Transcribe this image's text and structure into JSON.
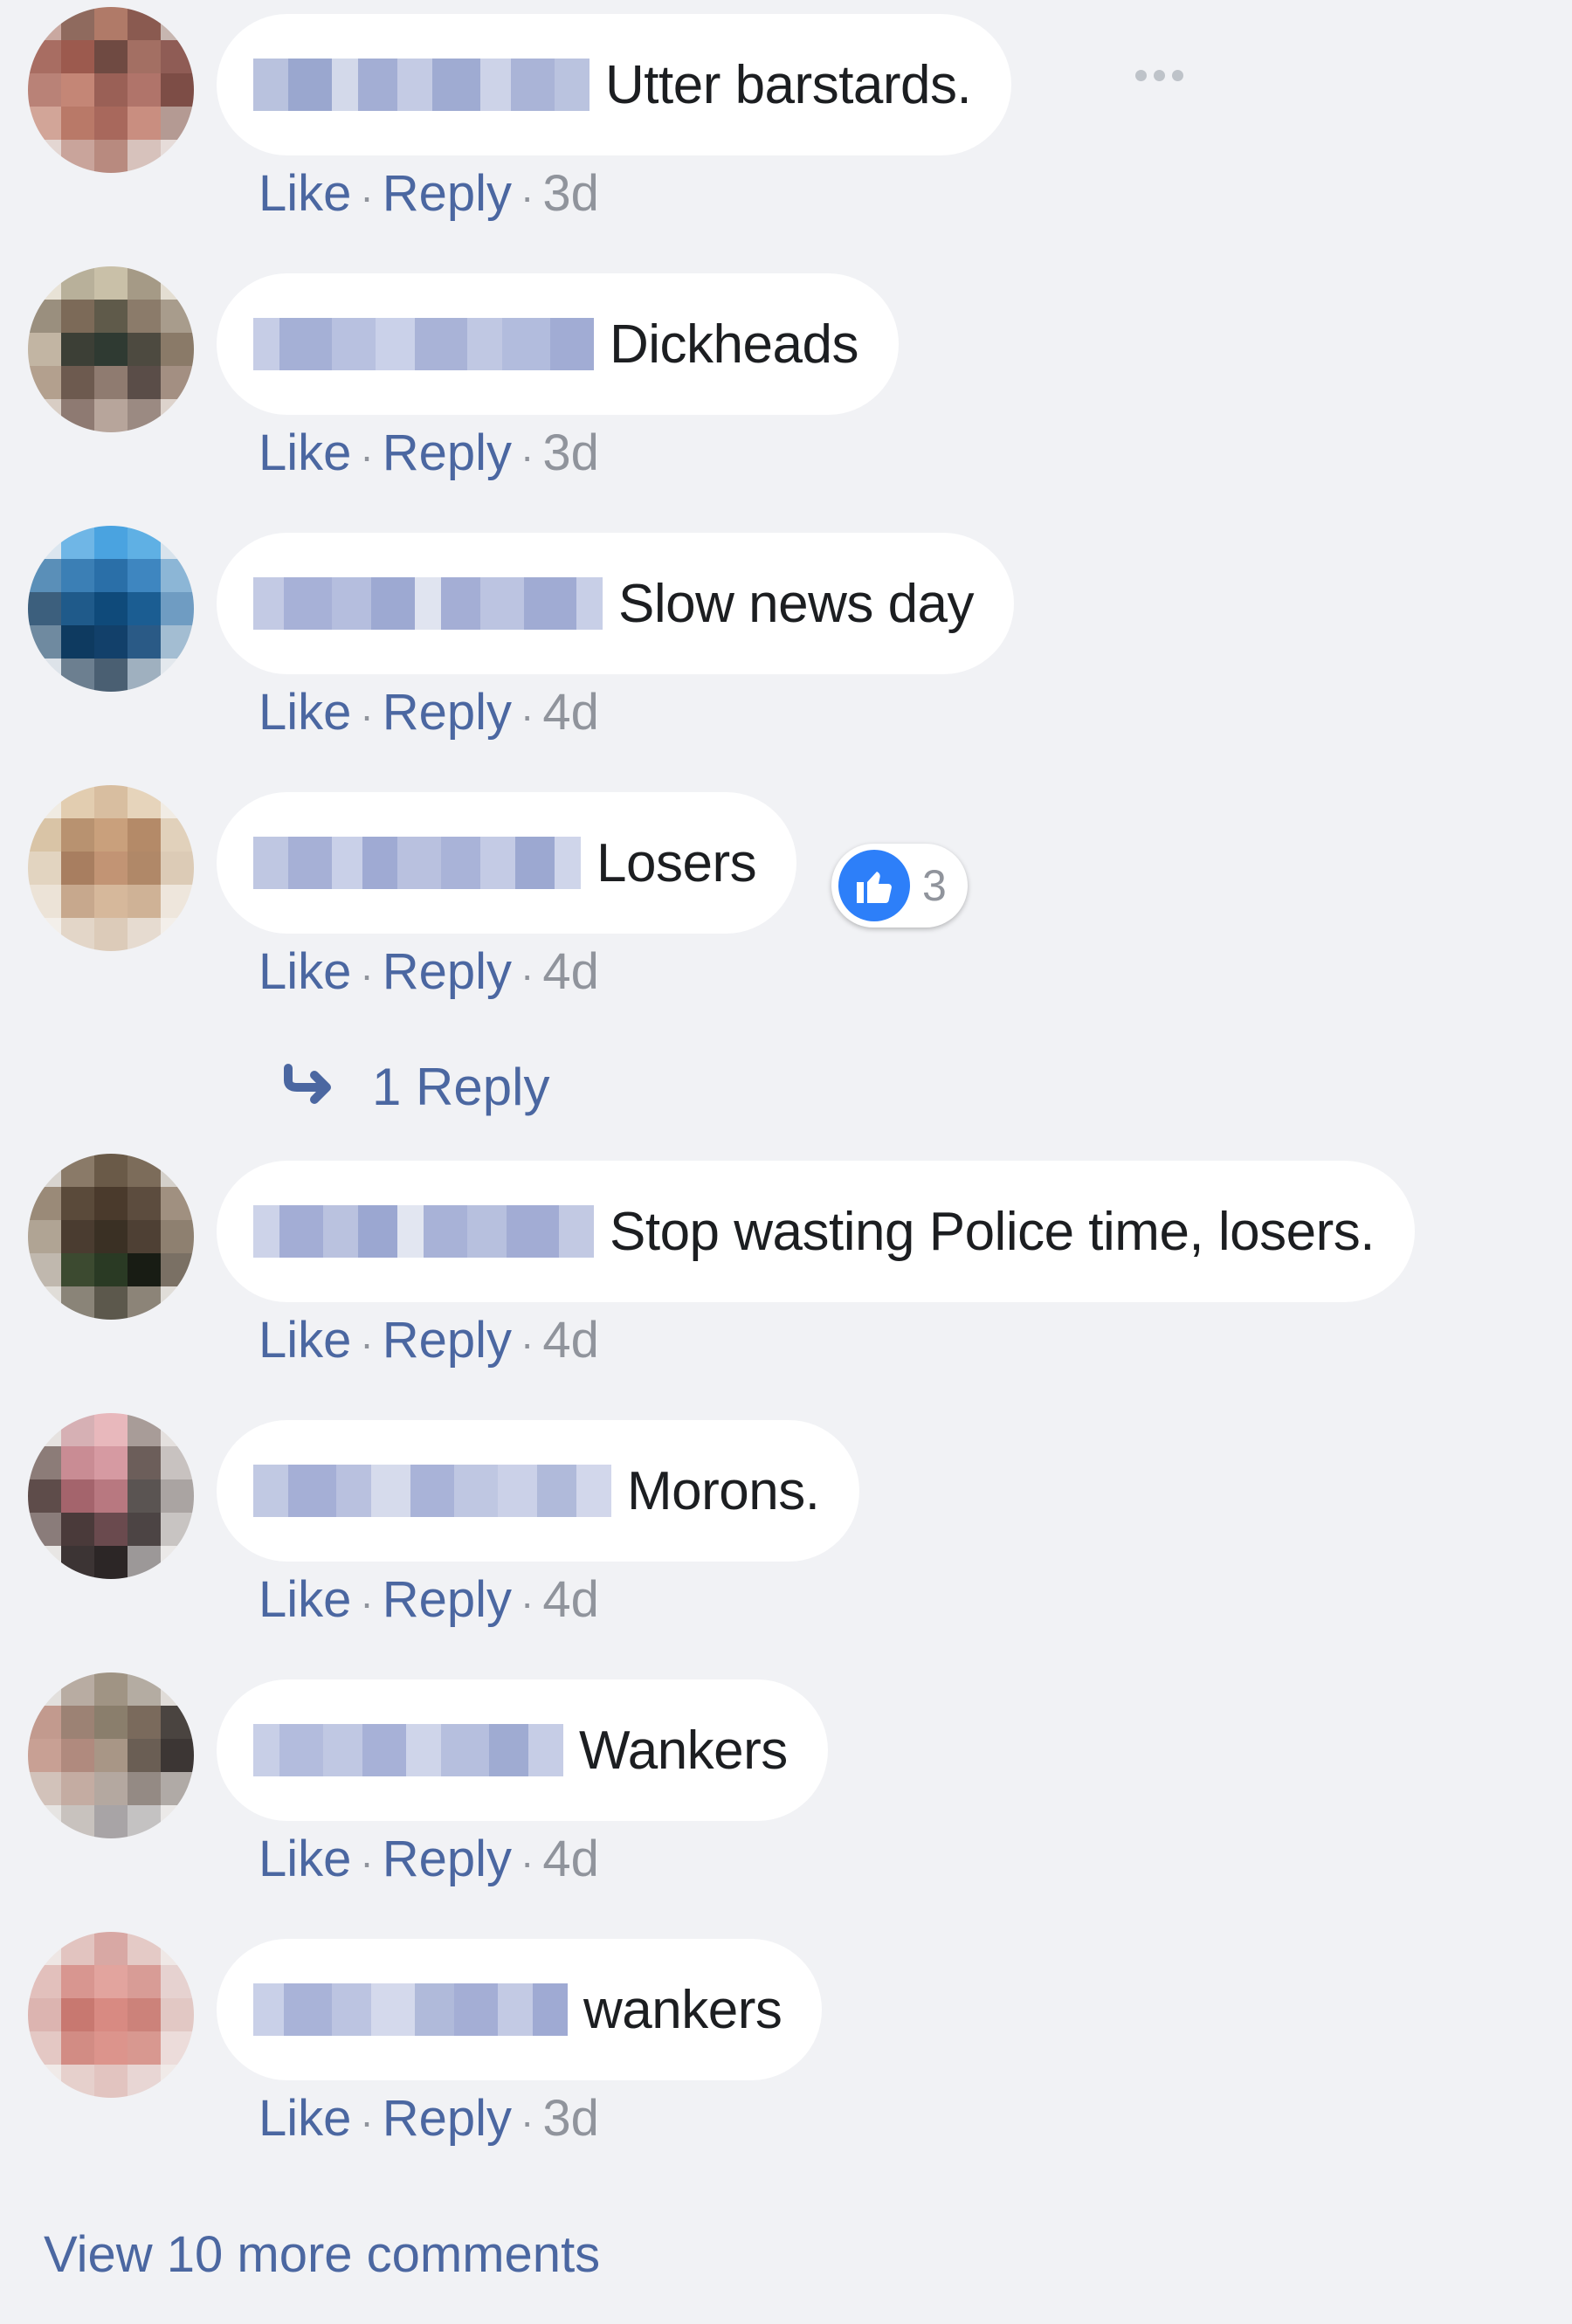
{
  "comments": [
    {
      "text": "Utter barstards.",
      "like": "Like",
      "reply": "Reply",
      "time": "3d"
    },
    {
      "text": "Dickheads",
      "like": "Like",
      "reply": "Reply",
      "time": "3d"
    },
    {
      "text": "Slow news day",
      "like": "Like",
      "reply": "Reply",
      "time": "4d"
    },
    {
      "text": "Losers",
      "like": "Like",
      "reply": "Reply",
      "time": "4d"
    },
    {
      "text": "Stop wasting Police time, losers.",
      "like": "Like",
      "reply": "Reply",
      "time": "4d"
    },
    {
      "text": "Morons.",
      "like": "Like",
      "reply": "Reply",
      "time": "4d"
    },
    {
      "text": "Wankers",
      "like": "Like",
      "reply": "Reply",
      "time": "4d"
    },
    {
      "text": "wankers",
      "like": "Like",
      "reply": "Reply",
      "time": "3d"
    }
  ],
  "reaction": {
    "count": "3",
    "icon": "thumbs-up-icon",
    "color": "#2d7ff9"
  },
  "replies_link": {
    "label": "1 Reply",
    "icon": "reply-arrow-icon"
  },
  "view_more": {
    "label": "View 10 more comments"
  },
  "colors": {
    "link": "#4b67a1",
    "meta": "#90949c",
    "text": "#1c1e21",
    "background": "#f1f2f5",
    "bubble": "#ffffff"
  }
}
